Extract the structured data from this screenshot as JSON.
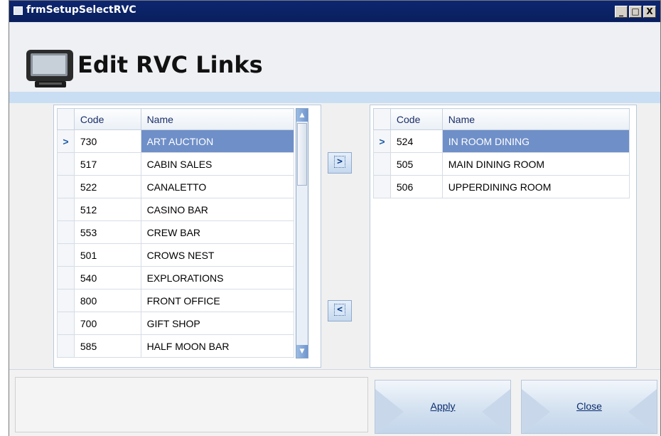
{
  "window": {
    "title": "frmSetupSelectRVC",
    "minimize": "_",
    "maximize": "□",
    "close": "X"
  },
  "header": {
    "title": "Edit RVC Links",
    "icon": "pos-terminal-icon"
  },
  "available_grid": {
    "columns": [
      "Code",
      "Name"
    ],
    "rows": [
      {
        "code": "730",
        "name": "ART AUCTION",
        "indicator": ">"
      },
      {
        "code": "517",
        "name": "CABIN SALES",
        "indicator": ""
      },
      {
        "code": "522",
        "name": "CANALETTO",
        "indicator": ""
      },
      {
        "code": "512",
        "name": "CASINO  BAR",
        "indicator": ""
      },
      {
        "code": "553",
        "name": "CREW BAR",
        "indicator": ""
      },
      {
        "code": "501",
        "name": "CROWS NEST",
        "indicator": ""
      },
      {
        "code": "540",
        "name": "EXPLORATIONS",
        "indicator": ""
      },
      {
        "code": "800",
        "name": "FRONT OFFICE",
        "indicator": ""
      },
      {
        "code": "700",
        "name": "GIFT SHOP",
        "indicator": ""
      },
      {
        "code": "585",
        "name": "HALF MOON BAR",
        "indicator": ""
      }
    ],
    "selected_index": 0
  },
  "linked_grid": {
    "columns": [
      "Code",
      "Name"
    ],
    "rows": [
      {
        "code": "524",
        "name": "IN ROOM DINING",
        "indicator": ">"
      },
      {
        "code": "505",
        "name": "MAIN DINING ROOM",
        "indicator": ""
      },
      {
        "code": "506",
        "name": "UPPERDINING ROOM",
        "indicator": ""
      }
    ],
    "selected_index": 0
  },
  "transfer": {
    "add_label": ">",
    "remove_label": "<"
  },
  "footer": {
    "apply_label": "Apply",
    "close_label": "Close"
  }
}
